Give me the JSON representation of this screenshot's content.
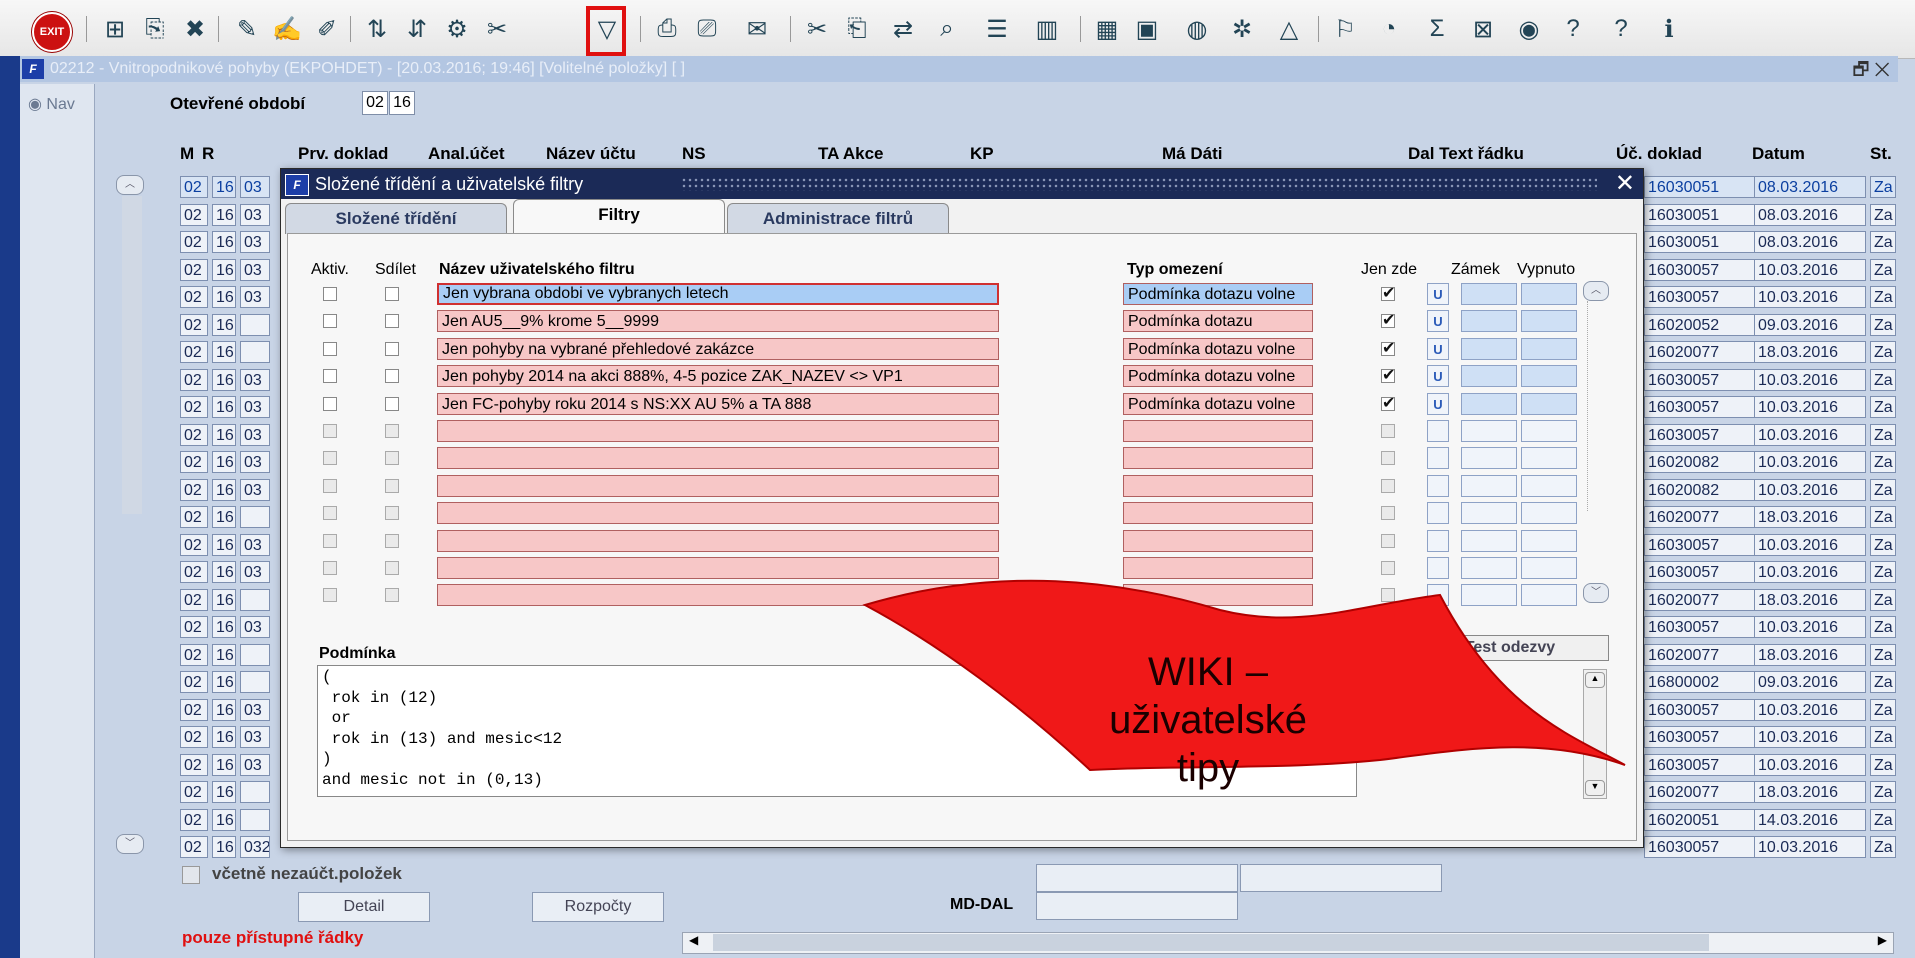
{
  "toolbar": {
    "exit_label": "EXIT",
    "icons": [
      "new-record-icon",
      "copy-record-icon",
      "delete-record-icon",
      "query-icon",
      "query-execute-icon",
      "query-cancel-icon",
      "sort-asc-icon",
      "sort-desc-icon",
      "tools-icon",
      "filter-icon",
      "print-icon",
      "preview-icon",
      "mail-icon",
      "cut-icon",
      "paste-icon",
      "import-icon",
      "search-icon",
      "list-icon",
      "columns-icon",
      "calc-icon",
      "save-icon",
      "globe-icon",
      "tree-icon",
      "chart-icon",
      "edit-icon",
      "clock-icon",
      "sum-icon",
      "excel-icon",
      "browser-icon",
      "help-icon",
      "help2-icon",
      "info-icon"
    ]
  },
  "window": {
    "title": "02212 - Vnitropodnikové pohyby (EKPOHDET) - [20.03.2016; 19:46]  [Volitelné položky]  [ ]",
    "controls": "🗗 ✕"
  },
  "nav": {
    "label": "Nav"
  },
  "period": {
    "label": "Otevřené období",
    "month": "02",
    "year": "16"
  },
  "columns": [
    "M",
    "R",
    "Prv. doklad",
    "Anal.účet",
    "Název účtu",
    "NS",
    "TA Akce",
    "KP",
    "Má Dáti",
    "Dal Text řádku",
    "Úč. doklad",
    "Datum",
    "St."
  ],
  "rows": [
    {
      "m": "02",
      "r": "16",
      "p": "03",
      "doc": "16030051",
      "date": "08.03.2016",
      "st": "Za"
    },
    {
      "m": "02",
      "r": "16",
      "p": "03",
      "doc": "16030051",
      "date": "08.03.2016",
      "st": "Za"
    },
    {
      "m": "02",
      "r": "16",
      "p": "03",
      "doc": "16030051",
      "date": "08.03.2016",
      "st": "Za"
    },
    {
      "m": "02",
      "r": "16",
      "p": "03",
      "doc": "16030057",
      "date": "10.03.2016",
      "st": "Za"
    },
    {
      "m": "02",
      "r": "16",
      "p": "03",
      "doc": "16030057",
      "date": "10.03.2016",
      "st": "Za"
    },
    {
      "m": "02",
      "r": "16",
      "p": "",
      "doc": "16020052",
      "date": "09.03.2016",
      "st": "Za"
    },
    {
      "m": "02",
      "r": "16",
      "p": "",
      "doc": "16020077",
      "date": "18.03.2016",
      "st": "Za"
    },
    {
      "m": "02",
      "r": "16",
      "p": "03",
      "doc": "16030057",
      "date": "10.03.2016",
      "st": "Za"
    },
    {
      "m": "02",
      "r": "16",
      "p": "03",
      "doc": "16030057",
      "date": "10.03.2016",
      "st": "Za"
    },
    {
      "m": "02",
      "r": "16",
      "p": "03",
      "doc": "16030057",
      "date": "10.03.2016",
      "st": "Za"
    },
    {
      "m": "02",
      "r": "16",
      "p": "03",
      "doc": "16020082",
      "date": "10.03.2016",
      "st": "Za"
    },
    {
      "m": "02",
      "r": "16",
      "p": "03",
      "doc": "16020082",
      "date": "10.03.2016",
      "st": "Za"
    },
    {
      "m": "02",
      "r": "16",
      "p": "",
      "doc": "16020077",
      "date": "18.03.2016",
      "st": "Za"
    },
    {
      "m": "02",
      "r": "16",
      "p": "03",
      "doc": "16030057",
      "date": "10.03.2016",
      "st": "Za"
    },
    {
      "m": "02",
      "r": "16",
      "p": "03",
      "doc": "16030057",
      "date": "10.03.2016",
      "st": "Za"
    },
    {
      "m": "02",
      "r": "16",
      "p": "",
      "doc": "16020077",
      "date": "18.03.2016",
      "st": "Za"
    },
    {
      "m": "02",
      "r": "16",
      "p": "03",
      "doc": "16030057",
      "date": "10.03.2016",
      "st": "Za"
    },
    {
      "m": "02",
      "r": "16",
      "p": "",
      "doc": "16020077",
      "date": "18.03.2016",
      "st": "Za"
    },
    {
      "m": "02",
      "r": "16",
      "p": "",
      "doc": "16800002",
      "date": "09.03.2016",
      "st": "Za"
    },
    {
      "m": "02",
      "r": "16",
      "p": "03",
      "doc": "16030057",
      "date": "10.03.2016",
      "st": "Za"
    },
    {
      "m": "02",
      "r": "16",
      "p": "03",
      "doc": "16030057",
      "date": "10.03.2016",
      "st": "Za"
    },
    {
      "m": "02",
      "r": "16",
      "p": "03",
      "doc": "16030057",
      "date": "10.03.2016",
      "st": "Za"
    },
    {
      "m": "02",
      "r": "16",
      "p": "",
      "doc": "16020077",
      "date": "18.03.2016",
      "st": "Za"
    },
    {
      "m": "02",
      "r": "16",
      "p": "",
      "doc": "16020051",
      "date": "14.03.2016",
      "st": "Za"
    },
    {
      "m": "02",
      "r": "16",
      "p": "032",
      "doc": "16030057",
      "date": "10.03.2016",
      "st": "Za"
    }
  ],
  "bottom": {
    "include_unposted_label": "včetně nezaúčt.položek",
    "detail_label": "Detail",
    "budget_label": "Rozpočty",
    "mddal_label": "MD-DAL",
    "access_label": "pouze přístupné řádky"
  },
  "dialog": {
    "title": "Složené třídění a uživatelské filtry",
    "close": "✕",
    "tabs": [
      {
        "label": "Složené třídění",
        "active": false
      },
      {
        "label": "Filtry",
        "active": true
      },
      {
        "label": "Administrace filtrů",
        "active": false
      }
    ],
    "headers": {
      "active": "Aktiv.",
      "share": "Sdílet",
      "name": "Název uživatelského filtru",
      "type": "Typ omezení",
      "only_here": "Jen zde",
      "lock": "Zámek",
      "off": "Vypnuto"
    },
    "filters": [
      {
        "name": "Jen vybrana obdobi ve vybranych letech",
        "type": "Podmínka dotazu volne",
        "only_here": true,
        "u": "U"
      },
      {
        "name": "Jen AU5__9% krome 5__9999",
        "type": "Podmínka dotazu",
        "only_here": true,
        "u": "U"
      },
      {
        "name": "Jen pohyby na vybrané přehledové zakázce",
        "type": "Podmínka dotazu volne",
        "only_here": true,
        "u": "U"
      },
      {
        "name": "Jen pohyby 2014 na akci 888%, 4-5 pozice ZAK_NAZEV <> VP1",
        "type": "Podmínka dotazu volne",
        "only_here": true,
        "u": "U"
      },
      {
        "name": "Jen FC-pohyby roku 2014 s NS:XX AU 5% a TA 888",
        "type": "Podmínka dotazu volne",
        "only_here": true,
        "u": "U"
      }
    ],
    "empty_rows": 7,
    "test_label": "Test odezvy",
    "condition_label": "Podmínka",
    "condition_lines": [
      "(",
      " rok in (12)",
      " or",
      " rok in (13) and mesic<12",
      ")",
      "and mesic not in (0,13)"
    ]
  },
  "wiki": {
    "text_line1": "WIKI – uživatelské",
    "text_line2": "tipy",
    "color": "#f01818"
  }
}
